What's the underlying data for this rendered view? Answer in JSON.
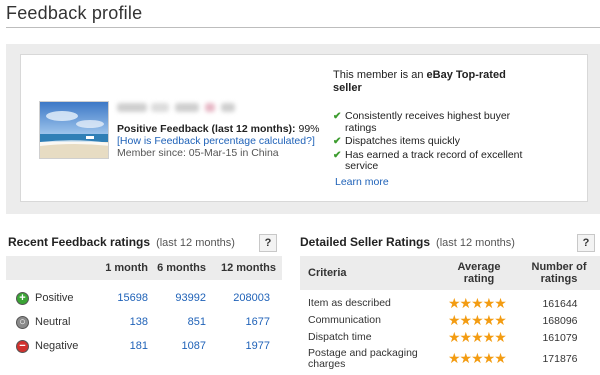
{
  "page": {
    "title": "Feedback profile"
  },
  "profile": {
    "positive_label": "Positive Feedback (last 12 months):",
    "positive_pct": "99%",
    "calc_link": "[How is Feedback percentage calculated?]",
    "member_since": "Member since: 05-Mar-15 in China"
  },
  "toprated": {
    "intro": "This member is an ",
    "badge": "eBay Top-rated seller",
    "points": [
      "Consistently receives highest buyer ratings",
      "Dispatches items quickly",
      "Has earned a track record of excellent service"
    ],
    "learn_more": "Learn more"
  },
  "recent": {
    "title": "Recent Feedback ratings",
    "subtitle": "(last 12 months)",
    "help": "?",
    "columns": [
      "1 month",
      "6 months",
      "12 months"
    ],
    "rows": [
      {
        "label": "Positive",
        "icon": "plus-circle-icon",
        "values": [
          "15698",
          "93992",
          "208003"
        ]
      },
      {
        "label": "Neutral",
        "icon": "neutral-circle-icon",
        "values": [
          "138",
          "851",
          "1677"
        ]
      },
      {
        "label": "Negative",
        "icon": "minus-circle-icon",
        "values": [
          "181",
          "1087",
          "1977"
        ]
      }
    ]
  },
  "dsr": {
    "title": "Detailed Seller Ratings",
    "subtitle": "(last 12 months)",
    "help": "?",
    "col_criteria": "Criteria",
    "col_avg": "Average rating",
    "col_num": "Number of ratings",
    "rows": [
      {
        "criteria": "Item as described",
        "stars": 5,
        "count": "161644"
      },
      {
        "criteria": "Communication",
        "stars": 5,
        "count": "168096"
      },
      {
        "criteria": "Dispatch time",
        "stars": 5,
        "count": "161079"
      },
      {
        "criteria": "Postage and packaging charges",
        "stars": 5,
        "count": "171876"
      }
    ]
  },
  "colors": {
    "link": "#1f62b8",
    "check": "#3d9c2f",
    "star": "#f39c12",
    "positive": "#3aa435",
    "neutral": "#8a8a8a",
    "negative": "#d0312d"
  }
}
